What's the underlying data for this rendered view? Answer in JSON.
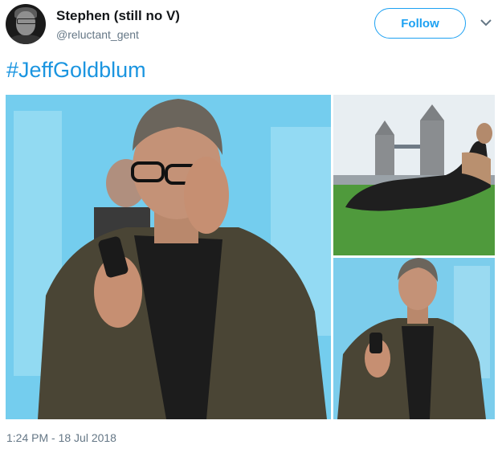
{
  "tweet": {
    "display_name": "Stephen (still no V)",
    "handle": "@reluctant_gent",
    "follow_label": "Follow",
    "hashtag": "#JeffGoldblum",
    "timestamp": "1:24 PM - 18 Jul 2018"
  },
  "icons": {
    "caret": "chevron-down-icon"
  },
  "colors": {
    "brand_blue": "#1da1f2",
    "hashtag_blue": "#1b95e0",
    "secondary_text": "#657786"
  }
}
